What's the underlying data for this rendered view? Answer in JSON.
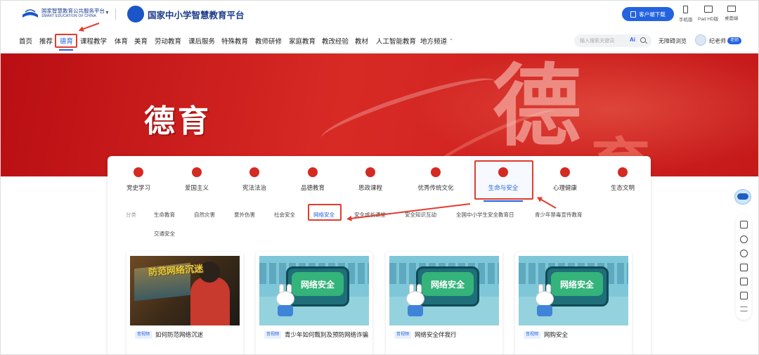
{
  "header": {
    "logo1_cn": "国家智慧教育公共服务平台",
    "logo1_en": "SMART EDUCATION OF CHINA",
    "platform_title": "国家中小学智慧教育平台",
    "download_label": "客户端下载",
    "devices": [
      "手机版",
      "Pad HD版",
      "桌面端"
    ]
  },
  "nav": {
    "items": [
      "首页",
      "推荐",
      "德育",
      "课程教学",
      "体育",
      "美育",
      "劳动教育",
      "课后服务",
      "特殊教育",
      "教师研修",
      "家庭教育",
      "教改经验",
      "教材",
      "人工智能教育",
      "地方频道"
    ],
    "active": "德育",
    "search_placeholder": "输入搜索关键词",
    "ai_label": "Ai",
    "accessibility": "无障碍浏览",
    "user_name": "纪老师",
    "user_badge": "老师"
  },
  "banner": {
    "title": "德育",
    "big_glyph": "德",
    "big_glyph2": "育"
  },
  "categories": {
    "items": [
      "党史学习",
      "爱国主义",
      "宪法法治",
      "品德教育",
      "思政课程",
      "优秀传统文化",
      "生命与安全",
      "心理健康",
      "生态文明"
    ],
    "active": "生命与安全"
  },
  "subcategories": {
    "label": "分类",
    "items": [
      "生命教育",
      "自然灾害",
      "意外伤害",
      "社会安全",
      "网络安全",
      "安全成长课堂",
      "安全知识互动",
      "全国中小学生安全教育日",
      "青少年禁毒宣传教育",
      "交通安全"
    ],
    "active": "网络安全"
  },
  "cards": [
    {
      "tag": "音视频",
      "title": "如何防范网络沉迷",
      "image_text": "防范网络沉迷"
    },
    {
      "tag": "音视频",
      "title": "青少年如何甄别及预防网络诈骗",
      "image_text": "网络安全"
    },
    {
      "tag": "音视频",
      "title": "网络安全伴我行",
      "image_text": "网络安全"
    },
    {
      "tag": "音视频",
      "title": "网购安全",
      "image_text": "网络安全"
    }
  ],
  "colors": {
    "accent": "#2463e0",
    "banner_red": "#c8191c",
    "annotation_red": "#e23b2e"
  },
  "sidebar_icons": [
    "home-icon",
    "help-icon",
    "cube-icon",
    "copy-icon",
    "document-icon",
    "feedback-icon",
    "menu-icon"
  ]
}
